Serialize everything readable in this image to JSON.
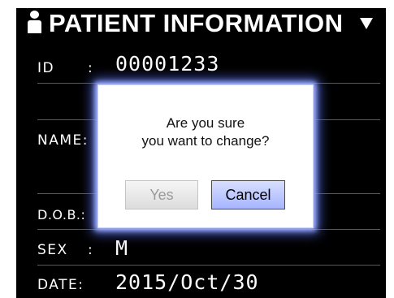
{
  "header": {
    "icon": "person-icon",
    "title": "PATIENT INFORMATION",
    "menu_icon": "dropdown-triangle-icon"
  },
  "fields": {
    "id": {
      "label": "ID",
      "colon": ":",
      "value": "00001233"
    },
    "name": {
      "label": "NAME:",
      "value": ""
    },
    "dob": {
      "label": "D.O.B.:",
      "value": ""
    },
    "sex": {
      "label": "SEX",
      "colon": ":",
      "value": "M"
    },
    "date": {
      "label": "DATE:",
      "value": "2015/Oct/30"
    }
  },
  "dialog": {
    "message_line1": "Are you sure",
    "message_line2": "you want to change?",
    "yes_label": "Yes",
    "yes_enabled": false,
    "cancel_label": "Cancel",
    "cancel_focused": true
  },
  "colors": {
    "screen_background": "#000000",
    "text": "#ffffff",
    "dialog_glow": "#4f64d8",
    "cancel_button": "#a6b5ff"
  }
}
